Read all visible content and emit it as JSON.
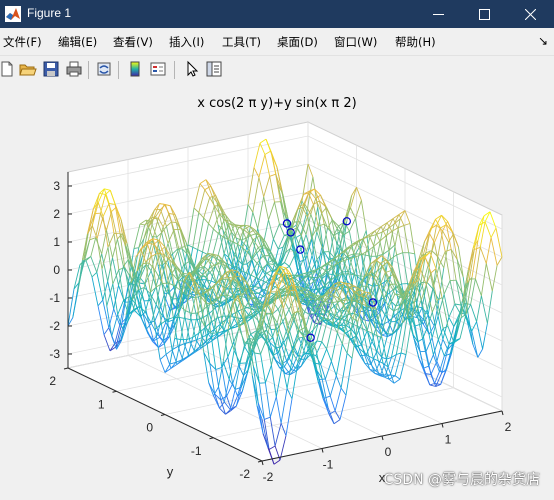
{
  "window": {
    "title": "Figure 1"
  },
  "menu": [
    "文件(F)",
    "编辑(E)",
    "查看(V)",
    "插入(I)",
    "工具(T)",
    "桌面(D)",
    "窗口(W)",
    "帮助(H)"
  ],
  "menu_more": "↘",
  "toolbar": [
    "new-figure",
    "open-file",
    "save",
    "print",
    "link-plot",
    "insert-colorbar",
    "insert-legend",
    "edit-plot",
    "property-inspector"
  ],
  "watermark": "CSDN @雾与晨的杂货店",
  "chart_data": {
    "type": "surface-mesh",
    "title": "x cos(2 π y)+y sin(x π 2)",
    "function": "z = x*cos(2*pi*y) + y*sin(x*pi*2)",
    "xlabel": "x",
    "ylabel": "y",
    "zlabel": "",
    "xlim": [
      -2,
      2
    ],
    "ylim": [
      -2,
      2
    ],
    "zlim": [
      -3.5,
      3.5
    ],
    "xticks": [
      "-2",
      "-1",
      "0",
      "1",
      "2"
    ],
    "yticks": [
      "-2",
      "-1",
      "0",
      "1",
      "2"
    ],
    "zticks": [
      "-3",
      "-2",
      "-1",
      "0",
      "1",
      "2",
      "3"
    ],
    "colormap": "parula",
    "grid": true,
    "markers": {
      "style": "circle",
      "color": "#0000cc"
    }
  }
}
